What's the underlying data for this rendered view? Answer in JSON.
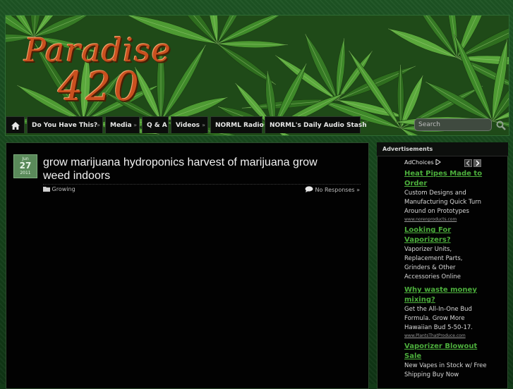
{
  "site": {
    "logo_line1": "Paradise",
    "logo_line2": "420"
  },
  "nav": {
    "home_icon": "home-icon",
    "items": [
      {
        "label": "Do You Have This?",
        "has_dropdown": true
      },
      {
        "label": "Media",
        "has_dropdown": true
      },
      {
        "label": "Q & A",
        "has_dropdown": false
      },
      {
        "label": "Videos",
        "has_dropdown": true
      },
      {
        "label": "NORML Radio",
        "has_dropdown": false
      },
      {
        "label": "NORML's Daily Audio Stash",
        "has_dropdown": false
      }
    ],
    "dropdown_glyph": "»"
  },
  "search": {
    "placeholder": "Search",
    "icon": "magnifier-icon"
  },
  "post": {
    "date": {
      "month": "Jun",
      "day": "27",
      "year": "2011"
    },
    "title": "grow marijuana hydroponics harvest of marijuana grow weed indoors",
    "category": "Growing",
    "category_icon": "folder-icon",
    "comments": "No Responses »",
    "comments_icon": "comment-bubble-icon"
  },
  "sidebar": {
    "heading": "Advertisements",
    "adchoices": "AdChoices",
    "ads": [
      {
        "headline": "Heat Pipes Made to Order",
        "body": "Custom Designs and Manufacturing Quick Turn Around on Prototypes",
        "url": "www.norenproducts.com"
      },
      {
        "headline": "Looking For Vaporizers?",
        "body": "Vaporizer Units, Replacement Parts, Grinders & Other Accessories Online",
        "url": ""
      },
      {
        "headline": "Why waste money mixing?",
        "body": "Get the All-In-One Bud Formula. Grow More Hawaiian Bud 5-50-17.",
        "url": "www.PlantsThatProduce.com"
      },
      {
        "headline": "Vaporizer Blowout Sale",
        "body": "New Vapes in Stock w/ Free Shipping Buy Now",
        "url": ""
      }
    ]
  },
  "colors": {
    "accent": "#4caf3c",
    "logo": "#c9501f",
    "background": "#123a17"
  }
}
